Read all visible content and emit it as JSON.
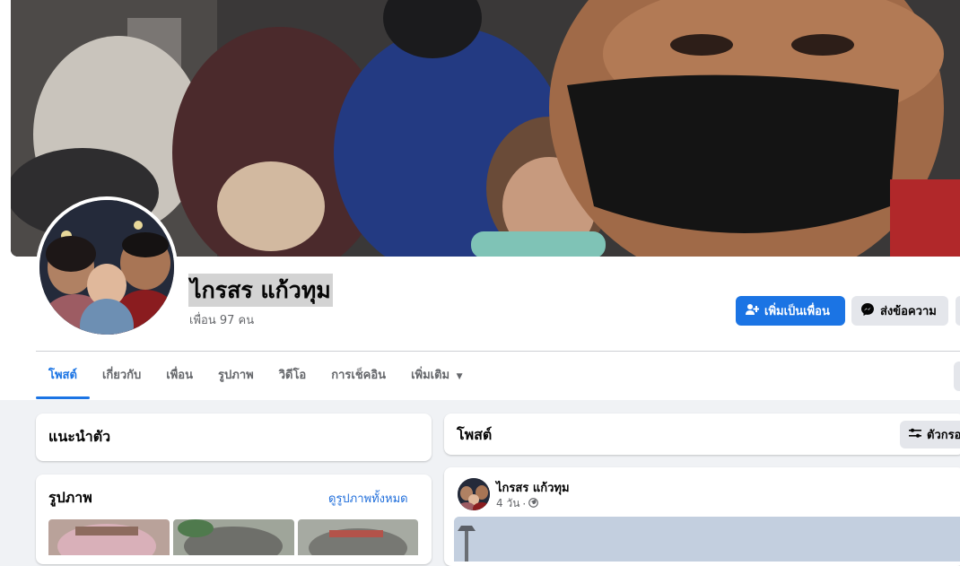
{
  "profile": {
    "name": "ไกรสร แก้วทุม",
    "friends_count": "เพื่อน 97 คน"
  },
  "actions": {
    "add_friend": "เพิ่มเป็นเพื่อน",
    "message": "ส่งข้อความ"
  },
  "tabs": [
    {
      "label": "โพสต์",
      "active": true
    },
    {
      "label": "เกี่ยวกับ",
      "active": false
    },
    {
      "label": "เพื่อน",
      "active": false
    },
    {
      "label": "รูปภาพ",
      "active": false
    },
    {
      "label": "วิดีโอ",
      "active": false
    },
    {
      "label": "การเช็คอิน",
      "active": false
    },
    {
      "label": "เพิ่มเติม",
      "active": false
    }
  ],
  "intro": {
    "title": "แนะนำตัว"
  },
  "photos": {
    "title": "รูปภาพ",
    "see_all": "ดูรูปภาพทั้งหมด"
  },
  "posts": {
    "title": "โพสต์",
    "filter_label": "ตัวกรอ"
  },
  "post": {
    "author": "ไกรสร แก้วทุม",
    "time": "4 วัน",
    "separator": "·",
    "privacy_icon": "globe-icon"
  },
  "colors": {
    "accent": "#1b74e4",
    "link": "#216fdb",
    "page_bg": "#f0f2f5",
    "secondary_button": "#e4e6eb",
    "name_highlight": "#d3d3d3"
  }
}
